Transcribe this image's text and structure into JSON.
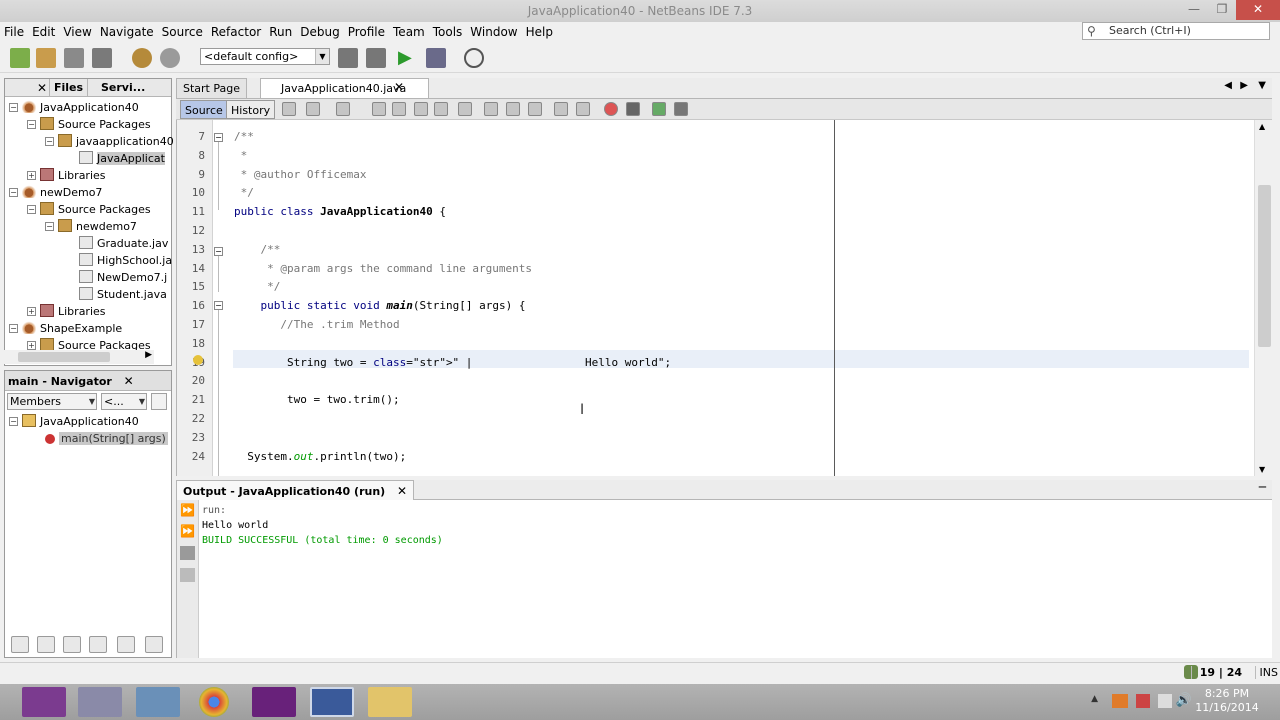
{
  "window": {
    "title": "JavaApplication40 - NetBeans IDE 7.3",
    "controls": [
      "—",
      "❐",
      "✕"
    ]
  },
  "menu": [
    "File",
    "Edit",
    "View",
    "Navigate",
    "Source",
    "Refactor",
    "Run",
    "Debug",
    "Profile",
    "Team",
    "Tools",
    "Window",
    "Help"
  ],
  "search": {
    "placeholder": "Search (Ctrl+I)"
  },
  "toolbar": {
    "config": "<default config>"
  },
  "projects": {
    "tabs": [
      "Files",
      "Servi..."
    ],
    "tree": [
      {
        "label": "JavaApplication40",
        "toggle": "−",
        "icon": "coffee"
      },
      {
        "label": "Source Packages",
        "toggle": "−",
        "icon": "pkg"
      },
      {
        "label": "javaapplication40",
        "toggle": "−",
        "icon": "pkg"
      },
      {
        "label": "JavaApplicat",
        "toggle": "",
        "icon": "file"
      },
      {
        "label": "Libraries",
        "toggle": "+",
        "icon": "lib"
      },
      {
        "label": "newDemo7",
        "toggle": "−",
        "icon": "coffee"
      },
      {
        "label": "Source Packages",
        "toggle": "−",
        "icon": "pkg"
      },
      {
        "label": "newdemo7",
        "toggle": "−",
        "icon": "pkg"
      },
      {
        "label": "Graduate.jav",
        "toggle": "",
        "icon": "file"
      },
      {
        "label": "HighSchool.ja",
        "toggle": "",
        "icon": "file"
      },
      {
        "label": "NewDemo7.j",
        "toggle": "",
        "icon": "file"
      },
      {
        "label": "Student.java",
        "toggle": "",
        "icon": "file"
      },
      {
        "label": "Libraries",
        "toggle": "+",
        "icon": "lib"
      },
      {
        "label": "ShapeExample",
        "toggle": "−",
        "icon": "coffee"
      },
      {
        "label": "Source Packages",
        "toggle": "+",
        "icon": "pkg"
      }
    ]
  },
  "navigator": {
    "title": "main - Navigator",
    "filter": "Members",
    "filter2": "<...",
    "root": "JavaApplication40",
    "member": "main(String[] args)"
  },
  "editor": {
    "tabs": [
      "Start Page",
      "JavaApplication40.java"
    ],
    "source_label": "Source",
    "history_label": "History",
    "lines": [
      {
        "n": "7",
        "text": "/**",
        "cls": "cmt"
      },
      {
        "n": "8",
        "text": " *",
        "cls": "cmt"
      },
      {
        "n": "9",
        "text": " * @author Officemax",
        "cls": "cmt"
      },
      {
        "n": "10",
        "text": " */",
        "cls": "cmt"
      },
      {
        "n": "11",
        "text": "public class JavaApplication40 {",
        "cls": ""
      },
      {
        "n": "12",
        "text": "",
        "cls": ""
      },
      {
        "n": "13",
        "text": "    /**",
        "cls": "cmt"
      },
      {
        "n": "14",
        "text": "     * @param args the command line arguments",
        "cls": "cmt"
      },
      {
        "n": "15",
        "text": "     */",
        "cls": "cmt"
      },
      {
        "n": "16",
        "text": "    public static void main(String[] args) {",
        "cls": ""
      },
      {
        "n": "17",
        "text": "       //The .trim Method",
        "cls": "cmt"
      },
      {
        "n": "18",
        "text": "",
        "cls": ""
      },
      {
        "n": "19",
        "text": "        String two = \" |                 Hello world\";",
        "cls": ""
      },
      {
        "n": "20",
        "text": "",
        "cls": ""
      },
      {
        "n": "21",
        "text": "        two = two.trim();",
        "cls": ""
      },
      {
        "n": "22",
        "text": "",
        "cls": ""
      },
      {
        "n": "23",
        "text": "",
        "cls": ""
      },
      {
        "n": "24",
        "text": "  System.out.println(two);",
        "cls": ""
      }
    ]
  },
  "output": {
    "tab": "Output - JavaApplication40 (run)",
    "lines": [
      {
        "text": "run:",
        "color": "#555555"
      },
      {
        "text": "Hello world",
        "color": "#000000"
      },
      {
        "text": "BUILD SUCCESSFUL (total time: 0 seconds)",
        "color": "#009a00"
      }
    ]
  },
  "status": {
    "position": "19 | 24",
    "mode": "INS"
  },
  "taskbar": {
    "time": "8:26 PM",
    "date": "11/16/2014"
  }
}
